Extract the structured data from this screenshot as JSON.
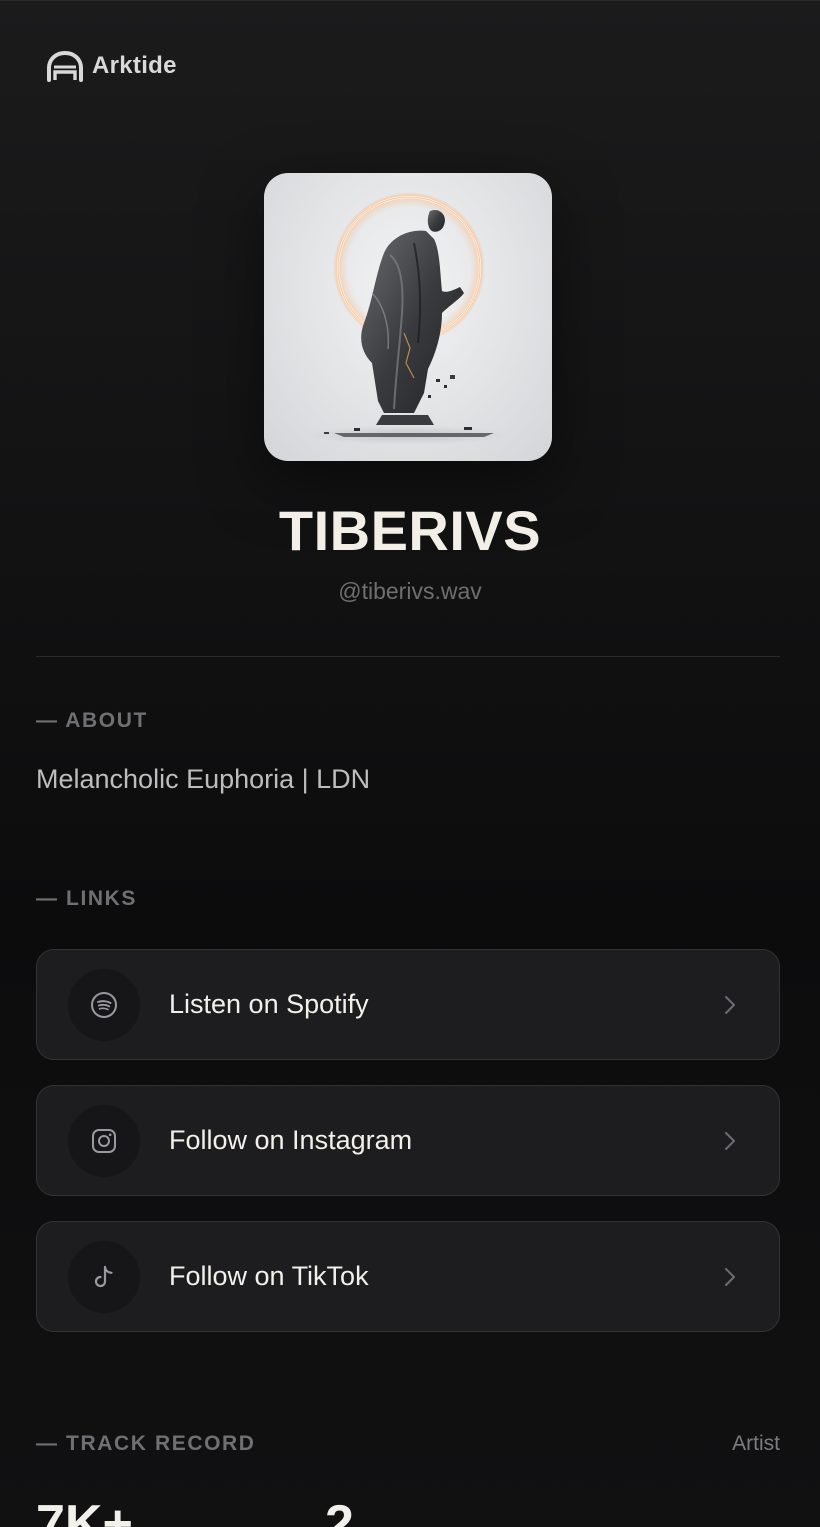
{
  "brand": {
    "name": "Arktide",
    "icon": "arch-logo-icon"
  },
  "profile": {
    "name": "TIBERIVS",
    "handle": "@tiberivs.wav",
    "avatar_icon": "statue-avatar-image"
  },
  "about": {
    "label": "— ABOUT",
    "text": "Melancholic Euphoria | LDN"
  },
  "links": {
    "label": "— LINKS",
    "items": [
      {
        "label": "Listen on Spotify",
        "icon": "spotify-icon"
      },
      {
        "label": "Follow on Instagram",
        "icon": "instagram-icon"
      },
      {
        "label": "Follow on TikTok",
        "icon": "tiktok-icon"
      }
    ]
  },
  "track_record": {
    "label": "— TRACK RECORD",
    "role": "Artist",
    "stats": [
      "7K+",
      "2"
    ]
  },
  "colors": {
    "background": "#131314",
    "card": "#1d1d1f",
    "card_border": "#333336",
    "title": "#f3efe6",
    "muted": "#707074"
  }
}
